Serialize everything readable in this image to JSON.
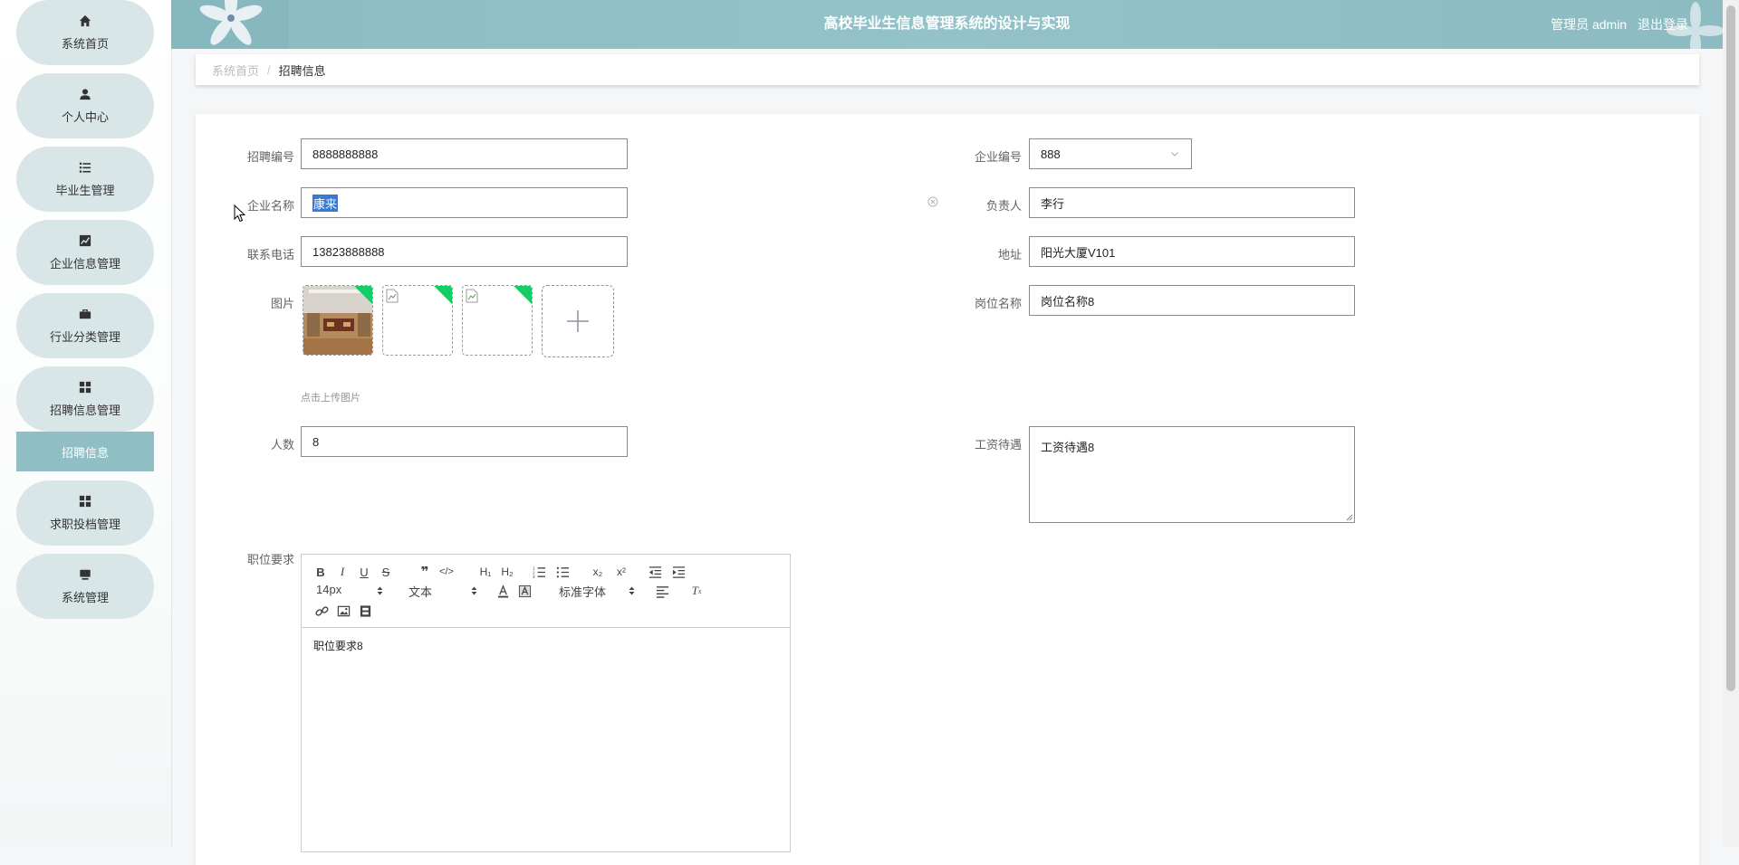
{
  "app": {
    "title": "高校毕业生信息管理系统的设计与实现",
    "user_label": "管理员 admin",
    "logout_label": "退出登录"
  },
  "sidebar": {
    "items": [
      {
        "label": "系统首页",
        "icon": "home-icon"
      },
      {
        "label": "个人中心",
        "icon": "user-icon"
      },
      {
        "label": "毕业生管理",
        "icon": "list-icon"
      },
      {
        "label": "企业信息管理",
        "icon": "chart-icon"
      },
      {
        "label": "行业分类管理",
        "icon": "briefcase-icon"
      },
      {
        "label": "招聘信息管理",
        "icon": "grid-icon"
      },
      {
        "label": "求职投档管理",
        "icon": "grid-icon"
      },
      {
        "label": "系统管理",
        "icon": "monitor-icon"
      }
    ],
    "active_sub_item": "招聘信息"
  },
  "breadcrumb": {
    "home": "系统首页",
    "separator": "/",
    "current": "招聘信息"
  },
  "form": {
    "recruit_no": {
      "label": "招聘编号",
      "value": "8888888888"
    },
    "company_no": {
      "label": "企业编号",
      "value": "888"
    },
    "company_name": {
      "label": "企业名称",
      "value": "康来"
    },
    "manager": {
      "label": "负责人",
      "value": "李行"
    },
    "phone": {
      "label": "联系电话",
      "value": "13823888888"
    },
    "address": {
      "label": "地址",
      "value": "阳光大厦V101"
    },
    "image": {
      "label": "图片",
      "upload_hint": "点击上传图片"
    },
    "position": {
      "label": "岗位名称",
      "value": "岗位名称8"
    },
    "headcount": {
      "label": "人数",
      "value": "8"
    },
    "salary": {
      "label": "工资待遇",
      "value": "工资待遇8"
    },
    "requirements": {
      "label": "职位要求",
      "content": "职位要求8",
      "toolbar": {
        "font_size": "14px",
        "heading_type": "文本",
        "font_family": "标准字体"
      }
    }
  },
  "colors": {
    "header_bg": "#8fbfc4",
    "menu_bg": "#d9e6e7",
    "active_sub_bg": "#8fbfc4",
    "upload_ok": "#13ce66",
    "selection": "#3a78d4"
  }
}
